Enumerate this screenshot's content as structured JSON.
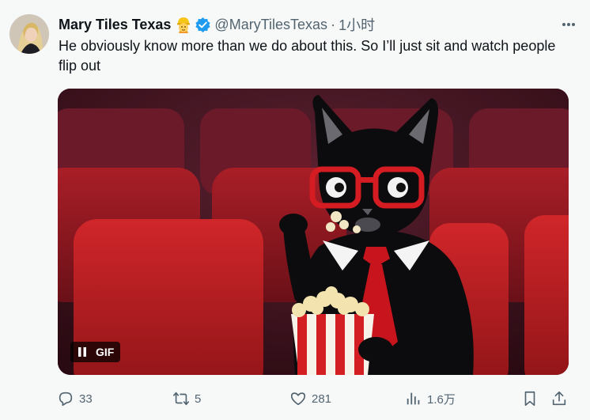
{
  "tweet": {
    "author": {
      "display_name": "Mary Tiles Texas",
      "handle": "@MaryTilesTexas",
      "emoji": "construction-worker-emoji",
      "verified": true,
      "verified_color": "#1d9bf0"
    },
    "separator": "·",
    "time": "1小时",
    "text": "He obviously know more than we do about this. So I’ll just sit and watch people flip out",
    "media": {
      "type": "GIF",
      "badge_label": "GIF",
      "icon": "pause-icon"
    },
    "actions": {
      "replies": "33",
      "reposts": "5",
      "likes": "281",
      "views": "1.6万"
    },
    "colors": {
      "text": "#0f1419",
      "muted": "#536471",
      "background": "#f7f9f9"
    }
  }
}
